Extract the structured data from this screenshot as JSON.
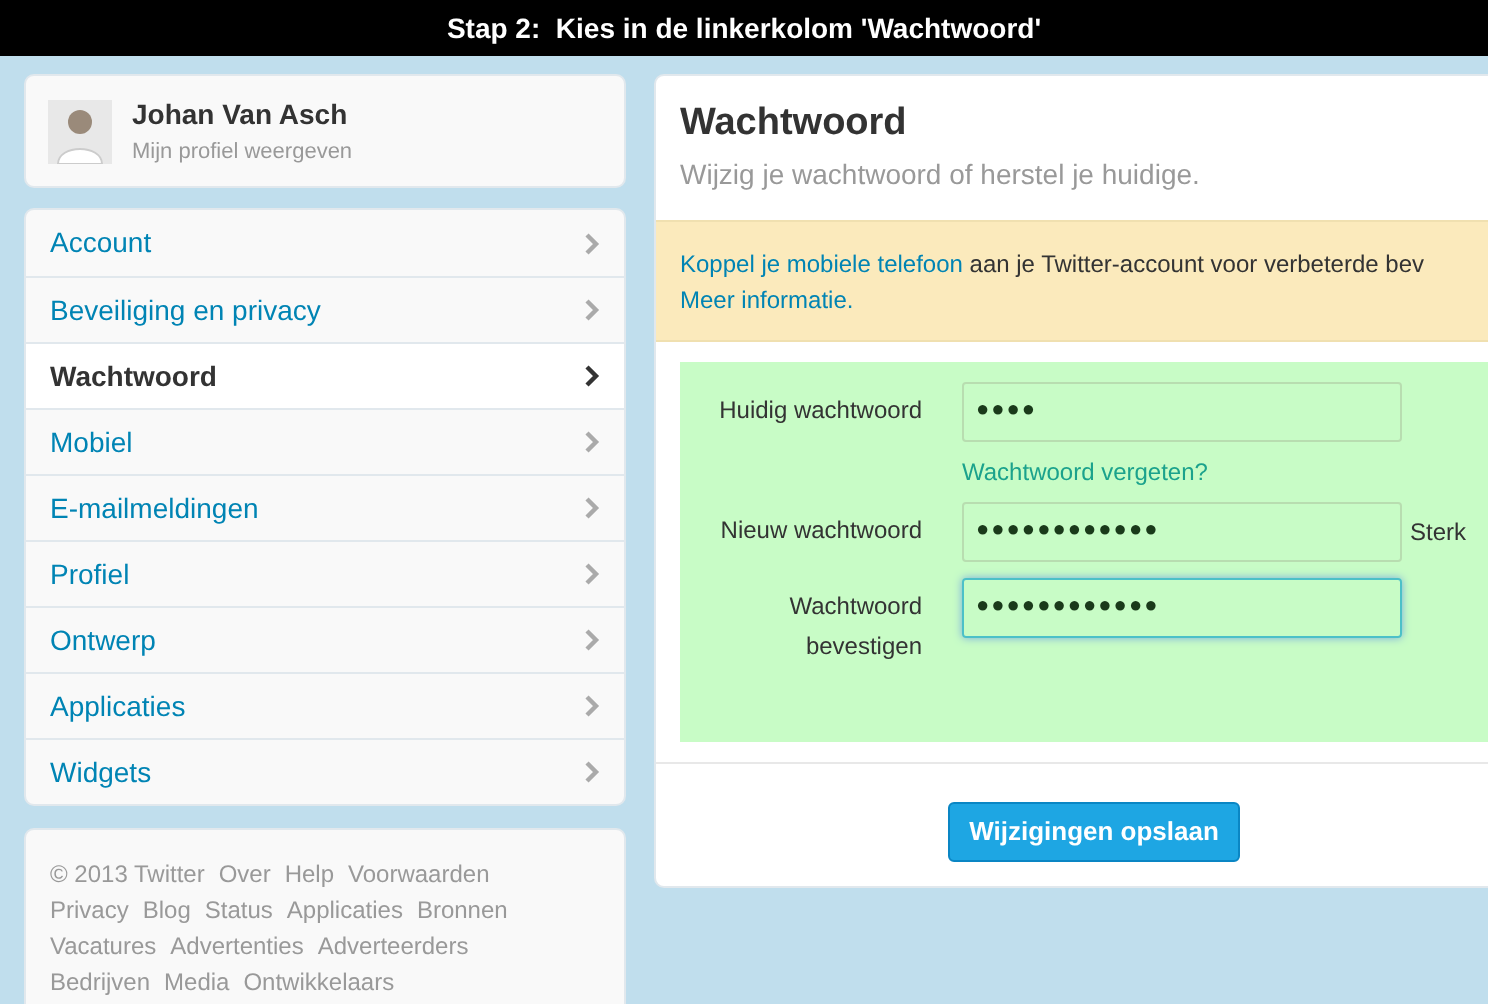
{
  "caption": "Stap 2:  Kies in de linkerkolom 'Wachtwoord'",
  "profile": {
    "name": "Johan Van Asch",
    "subtitle": "Mijn profiel weergeven"
  },
  "menu": [
    {
      "label": "Account",
      "selected": false
    },
    {
      "label": "Beveiliging en privacy",
      "selected": false
    },
    {
      "label": "Wachtwoord",
      "selected": true
    },
    {
      "label": "Mobiel",
      "selected": false
    },
    {
      "label": "E-mailmeldingen",
      "selected": false
    },
    {
      "label": "Profiel",
      "selected": false
    },
    {
      "label": "Ontwerp",
      "selected": false
    },
    {
      "label": "Applicaties",
      "selected": false
    },
    {
      "label": "Widgets",
      "selected": false
    }
  ],
  "footer": [
    [
      "© 2013 Twitter",
      "Over",
      "Help",
      "Voorwaarden"
    ],
    [
      "Privacy",
      "Blog",
      "Status",
      "Applicaties",
      "Bronnen"
    ],
    [
      "Vacatures",
      "Advertenties",
      "Adverteerders"
    ],
    [
      "Bedrijven",
      "Media",
      "Ontwikkelaars"
    ]
  ],
  "panel": {
    "title": "Wachtwoord",
    "subtitle": "Wijzig je wachtwoord of herstel je huidige.",
    "notice": {
      "link": "Koppel je mobiele telefoon",
      "text": " aan je Twitter-account voor verbeterde bev",
      "more_link": "Meer informatie."
    },
    "fields": [
      {
        "label": "Huidig wachtwoord",
        "value": "●●●●",
        "focused": false,
        "link": "Wachtwoord vergeten?"
      },
      {
        "label": "Nieuw wachtwoord",
        "value": "●●●●●●●●●●●●",
        "focused": false,
        "hint": "Sterk"
      },
      {
        "label": "Wachtwoord bevestigen",
        "value": "●●●●●●●●●●●●",
        "focused": true
      }
    ],
    "save_button": "Wijzigingen opslaan"
  }
}
